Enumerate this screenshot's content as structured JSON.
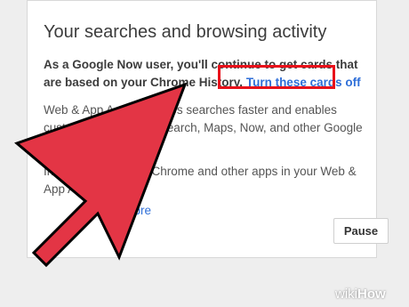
{
  "card": {
    "title": "Your searches and browsing activity",
    "notice_text": "As a Google Now user, you'll continue to get cards that are based on your Chrome History.",
    "notice_link": "Turn these cards off",
    "body_text_1": "Web & App Activity makes searches faster and enables customized results in Search, Maps, Now, and other Google products.",
    "body_text_2": "Include history from Chrome and other apps in your Web & App Activity",
    "link_text": "Learn more",
    "pause_label": "Pause"
  },
  "watermark": {
    "wiki": "wiki",
    "how": "How"
  },
  "colors": {
    "link": "#2f6fd8",
    "highlight": "#e8101a",
    "arrow": "#e33545"
  },
  "icons": {
    "pointer": "big-red-arrow-icon"
  }
}
